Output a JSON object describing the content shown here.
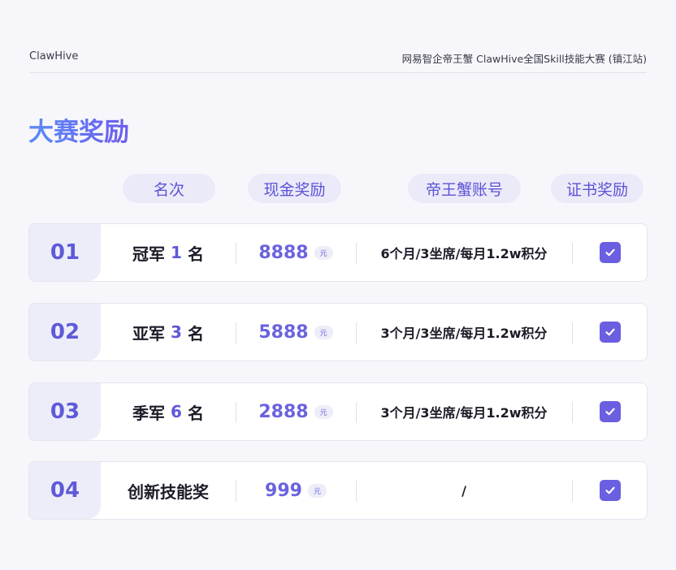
{
  "header": {
    "brand": "ClawHive",
    "event_title": "网易智企帝王蟹 ClawHive全国Skill技能大赛 (镇江站)"
  },
  "section_title": "大赛奖励",
  "columns": [
    "名次",
    "现金奖励",
    "帝王蟹账号",
    "证书奖励"
  ],
  "colors": {
    "accent": "#6a5fe0",
    "title_gradient_start": "#5b8cf5",
    "title_gradient_end": "#6d5cf0",
    "number_block_bg": "#ededfa"
  },
  "rows": [
    {
      "number": "01",
      "place_prefix": "冠军",
      "place_count": "1",
      "place_suffix": "名",
      "cash": "8888",
      "cash_unit": "元",
      "account": "6个月/3坐席/每月1.2w积分",
      "certificate": true,
      "certificate_icon": "check-icon"
    },
    {
      "number": "02",
      "place_prefix": "亚军",
      "place_count": "3",
      "place_suffix": "名",
      "cash": "5888",
      "cash_unit": "元",
      "account": "3个月/3坐席/每月1.2w积分",
      "certificate": true,
      "certificate_icon": "check-icon"
    },
    {
      "number": "03",
      "place_prefix": "季军",
      "place_count": "6",
      "place_suffix": "名",
      "cash": "2888",
      "cash_unit": "元",
      "account": "3个月/3坐席/每月1.2w积分",
      "certificate": true,
      "certificate_icon": "check-icon"
    },
    {
      "number": "04",
      "place_prefix": "创新技能奖",
      "place_count": "",
      "place_suffix": "",
      "cash": "999",
      "cash_unit": "元",
      "account": "/",
      "certificate": true,
      "certificate_icon": "check-icon"
    }
  ]
}
